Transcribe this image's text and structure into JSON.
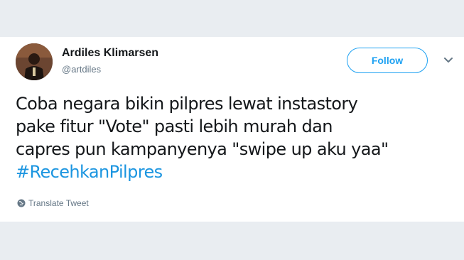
{
  "tweet": {
    "author_name": "Ardiles Klimarsen",
    "author_handle": "@artdiles",
    "follow_label": "Follow",
    "text_lines": [
      "Coba negara bikin pilpres lewat instastory",
      "pake fitur \"Vote\" pasti lebih murah dan",
      "capres pun kampanyenya \"swipe up aku yaa\""
    ],
    "hashtag": "#RecehkanPilpres",
    "translate_label": "Translate Tweet",
    "icons": {
      "menu": "chevron-down-icon",
      "translate": "globe-icon"
    },
    "colors": {
      "accent": "#1da1f2",
      "hashtag": "#1b95e0",
      "text": "#14171a",
      "muted": "#657786"
    }
  }
}
